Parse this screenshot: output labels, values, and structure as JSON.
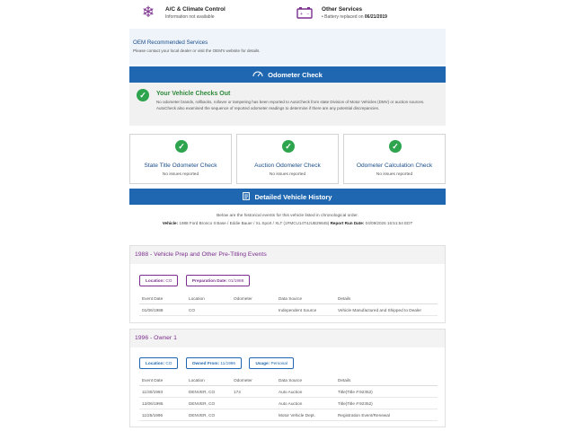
{
  "top_cards": {
    "left": {
      "icon": "snowflake-icon",
      "title": "A/C & Climate Control",
      "subtitle": "Information not available"
    },
    "right": {
      "icon": "battery-icon",
      "title": "Other Services",
      "bullet_text": "Battery replaced on ",
      "bullet_date": "06/21/2019"
    }
  },
  "oem": {
    "title": "OEM Recommended Services",
    "subtitle": "Please contact your local dealer or visit the OEM's website for details."
  },
  "odometer_bar": {
    "icon": "gauge-icon",
    "label": "Odometer Check"
  },
  "checks_out": {
    "title": "Your Vehicle Checks Out",
    "description": "No odometer brands, rollbacks, rollover or tampering has been reported to AutoCheck from state Division of Motor Vehicles (DMV) or auction sources. AutoCheck also examined the sequence of reported odometer readings to determine if there are any potential discrepancies."
  },
  "odometer_cards": [
    {
      "title": "State Title Odometer Check",
      "status": "No issues reported"
    },
    {
      "title": "Auction Odometer Check",
      "status": "No issues reported"
    },
    {
      "title": "Odometer Calculation Check",
      "status": "No issues reported"
    }
  ],
  "history_bar": {
    "icon": "document-icon",
    "label": "Detailed Vehicle History"
  },
  "history_intro": {
    "line1": "Below are the historical events for this vehicle listed in chronological order.",
    "vehicle_label": "Vehicle:",
    "vehicle_value": "1988 Ford Bronco II Base / Eddie Bauer / XL Sport / XLT (1FMCU14T4JUB29845)",
    "report_label": "Report Run Date:",
    "report_value": "04/09/2026 16:51:54 EDT"
  },
  "columns": [
    "Event Date",
    "Location",
    "Odometer",
    "Data Source",
    "Details"
  ],
  "event_group_1": {
    "heading": "1988 - Vehicle Prep and Other Pre-Titling Events",
    "pills": [
      {
        "label": "Location:",
        "value": "CO"
      },
      {
        "label": "Preparation Date:",
        "value": "01/1988"
      }
    ],
    "rows": [
      [
        "01/06/1988",
        "CO",
        "",
        "Independent Source",
        "Vehicle Manufactured and Shipped to Dealer"
      ]
    ]
  },
  "event_group_2": {
    "heading": "1996 - Owner   1",
    "pills": [
      {
        "label": "Location:",
        "value": "CO"
      },
      {
        "label": "Owned From:",
        "value": "11/1996"
      },
      {
        "label": "Usage:",
        "value": "Personal"
      }
    ],
    "rows": [
      [
        "11/30/1993",
        "DENVER, CO",
        "174",
        "Auto Auction",
        "Title(Title #:92352)"
      ],
      [
        "12/06/1995",
        "DENVER, CO",
        "",
        "Auto Auction",
        "Title(Title #:92352)"
      ],
      [
        "11/25/1996",
        "DENVER, CO",
        "",
        "Motor Vehicle Dept.",
        "Registration Event/Renewal"
      ]
    ]
  },
  "colors": {
    "purple": "#7b2e8e",
    "blue": "#1f67b1",
    "green": "#2ea44f"
  }
}
